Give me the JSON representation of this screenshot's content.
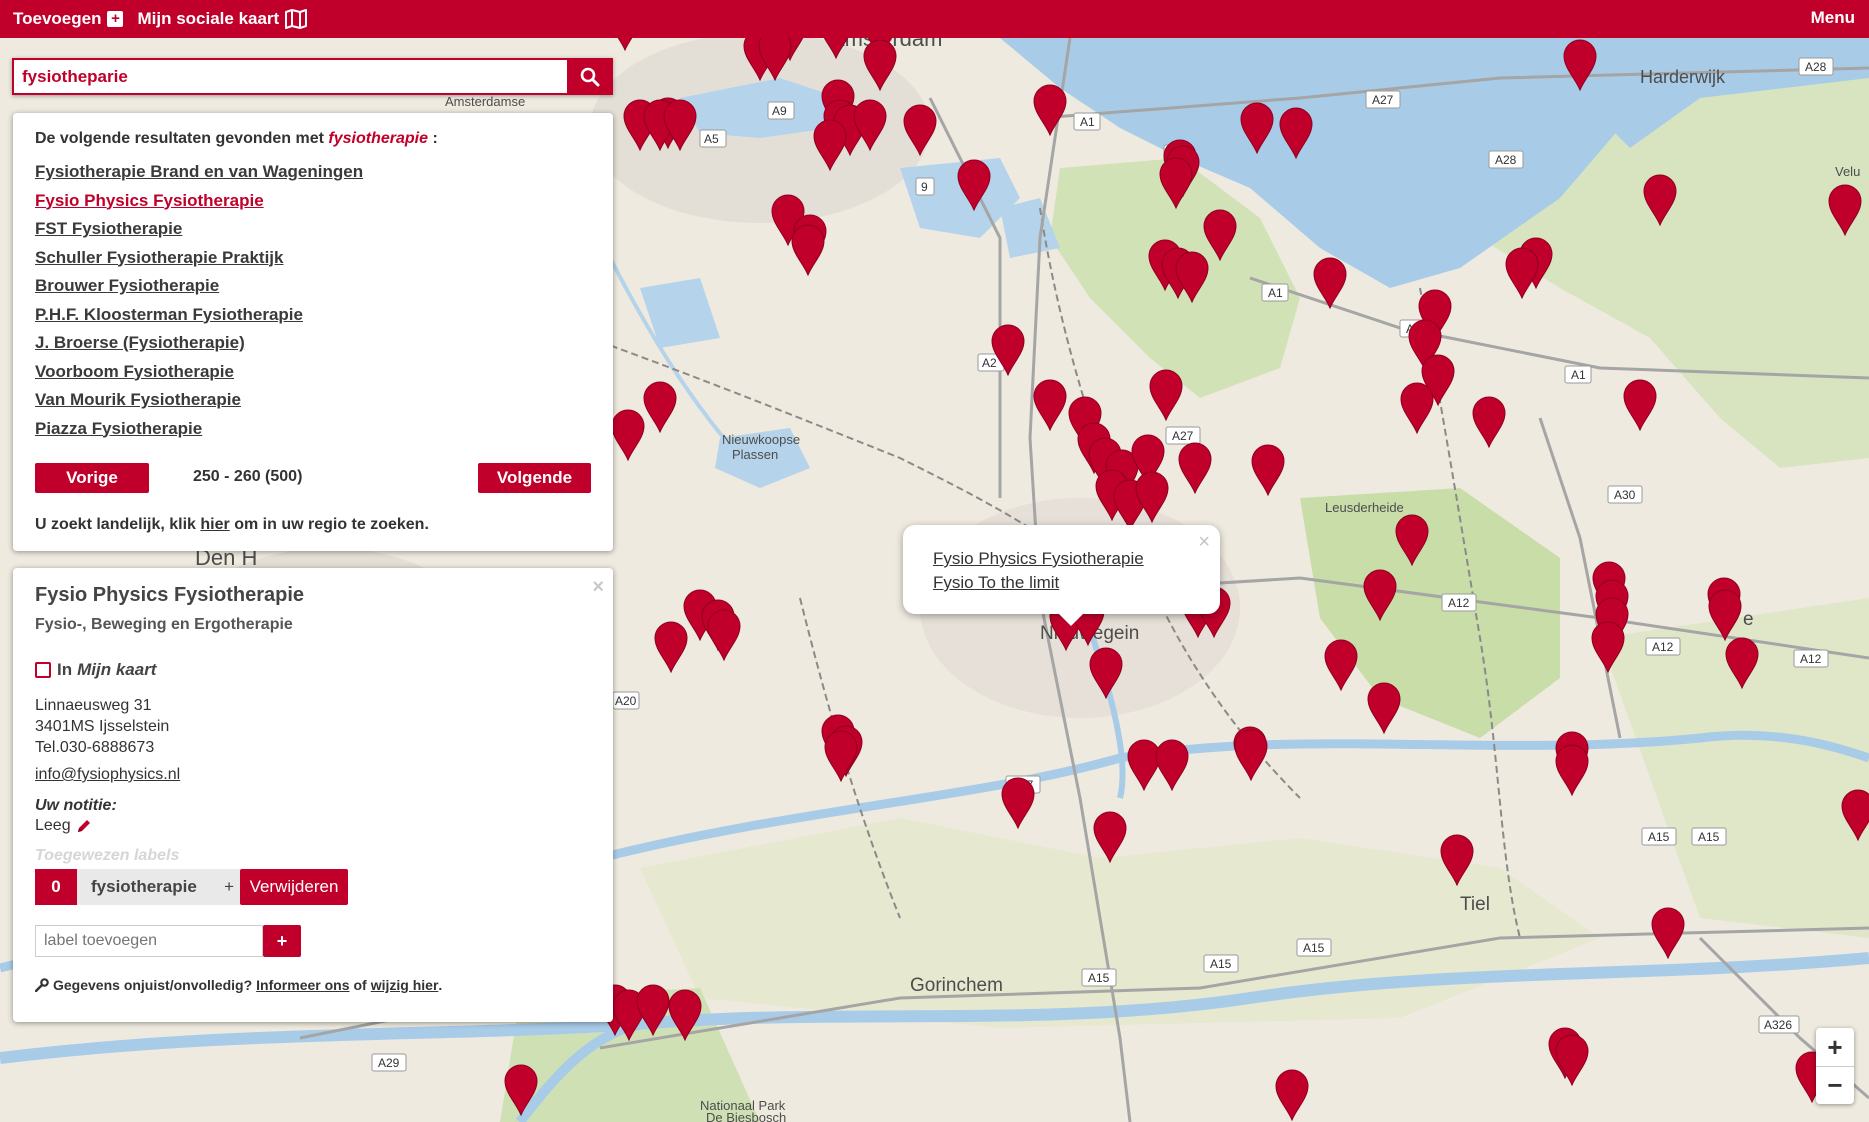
{
  "topbar": {
    "add_label": "Toevoegen",
    "my_map_label": "Mijn sociale kaart",
    "menu_label": "Menu"
  },
  "search": {
    "value": "fysiotheparie",
    "button_icon": "search-icon"
  },
  "results": {
    "intro_prefix": "De volgende resultaten gevonden met",
    "intro_term": "fysiotherapie",
    "intro_suffix": ":",
    "items": [
      "Fysiotherapie Brand en van Wageningen",
      "Fysio Physics Fysiotherapie",
      "FST Fysiotherapie",
      "Schuller Fysiotherapie Praktijk",
      "Brouwer Fysiotherapie",
      "P.H.F. Kloosterman Fysiotherapie",
      "J. Broerse (Fysiotherapie)",
      "Voorboom Fysiotherapie",
      "Van Mourik Fysiotherapie",
      "Piazza Fysiotherapie"
    ],
    "active_index": 1,
    "prev_label": "Vorige",
    "next_label": "Volgende",
    "range": "250 - 260 (500)",
    "region_prefix": "U zoekt landelijk, klik",
    "region_link": "hier",
    "region_suffix": "om in uw regio te zoeken."
  },
  "detail": {
    "title": "Fysio Physics Fysiotherapie",
    "subtitle": "Fysio-, Beweging en Ergotherapie",
    "in_label": "In",
    "mijn_kaart": "Mijn kaart",
    "street": "Linnaeusweg 31",
    "city": "3401MS Ijsselstein",
    "phone": "Tel.030-6888673",
    "email": "info@fysiophysics.nl",
    "note_label": "Uw notitie:",
    "note_value": "Leeg",
    "labels_heading": "Toegewezen labels",
    "label_count": "0",
    "label_name": "fysiotherapie",
    "label_plus": "+",
    "remove_label": "Verwijderen",
    "add_label_placeholder": "label toevoegen",
    "add_label_button": "+",
    "foot_prefix": "Gegevens onjuist/onvolledig?",
    "foot_link1": "Informeer ons",
    "foot_mid": "of",
    "foot_link2": "wijzig hier",
    "foot_end": ".",
    "close_symbol": "×"
  },
  "popup": {
    "links": [
      "Fysio Physics Fysiotherapie",
      "Fysio To the limit"
    ],
    "close_symbol": "×"
  },
  "zoom": {
    "in": "+",
    "out": "−"
  },
  "map_labels": {
    "places": [
      "Harderwijk",
      "Amsterdamse",
      "Nieuwkoopse",
      "Plassen",
      "Leusderheide",
      "Nieuwegein",
      "Den H",
      "Gorinchem",
      "Tiel",
      "Nationaal Park",
      "De Biesbosch",
      "Velu",
      "e",
      "Amsterdam"
    ],
    "roads": [
      "A28",
      "A27",
      "A1",
      "A5",
      "A9",
      "A28",
      "A1",
      "A1",
      "A1",
      "A1",
      "A30",
      "A12",
      "A12",
      "A12",
      "A2",
      "A27",
      "A27",
      "A15",
      "A15",
      "A15",
      "A15",
      "A15",
      "A29",
      "A326",
      "A20",
      "9"
    ]
  },
  "colors": {
    "brand": "#c0002a",
    "water": "#a8cce8",
    "land": "#efeadf",
    "forest": "#cfe0b4"
  }
}
